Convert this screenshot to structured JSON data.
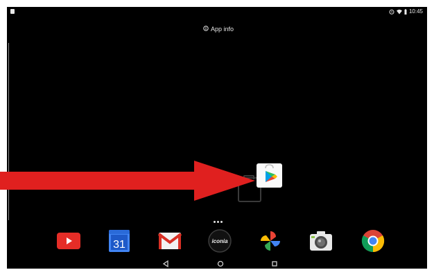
{
  "status_bar": {
    "time": "10:45"
  },
  "context_menu": {
    "app_info_label": "App info"
  },
  "dock": {
    "apps": [
      {
        "name": "YouTube",
        "icon": "youtube-icon"
      },
      {
        "name": "Calendar",
        "icon": "calendar-icon",
        "day": "31"
      },
      {
        "name": "Gmail",
        "icon": "gmail-icon"
      },
      {
        "name": "iconia",
        "icon": "iconia-icon",
        "label": "iconia"
      },
      {
        "name": "Photos",
        "icon": "photos-icon"
      },
      {
        "name": "Camera",
        "icon": "camera-icon"
      },
      {
        "name": "Chrome",
        "icon": "chrome-icon"
      }
    ]
  },
  "colors": {
    "arrow": "#e0201f",
    "screen_bg": "#000000"
  }
}
